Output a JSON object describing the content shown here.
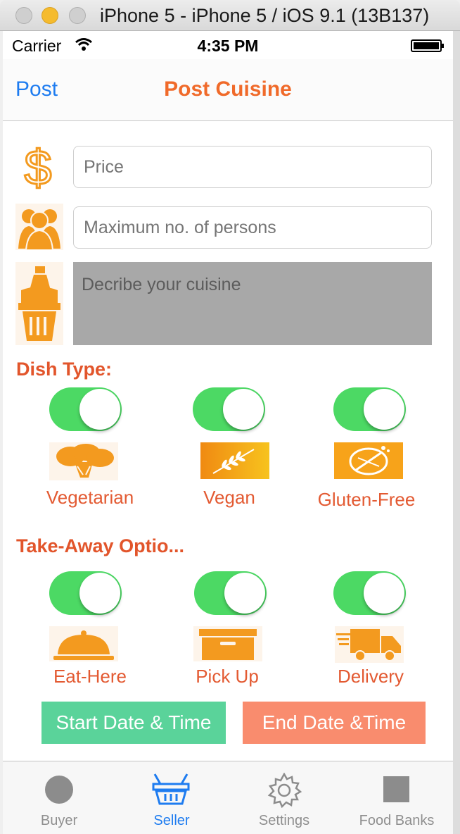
{
  "window": {
    "title": "iPhone 5 - iPhone 5 / iOS 9.1 (13B137)"
  },
  "status": {
    "carrier": "Carrier",
    "time": "4:35 PM"
  },
  "nav": {
    "left": "Post",
    "title": "Post Cuisine"
  },
  "form": {
    "price_placeholder": "Price",
    "persons_placeholder": "Maximum no. of persons",
    "describe_placeholder": "Decribe your cuisine"
  },
  "dish_type": {
    "title": "Dish Type:",
    "options": [
      {
        "label": "Vegetarian",
        "on": true,
        "icon": "broccoli-icon"
      },
      {
        "label": "Vegan",
        "on": true,
        "icon": "wheat-icon"
      },
      {
        "label": "Gluten-Free",
        "on": true,
        "icon": "no-gluten-icon"
      }
    ]
  },
  "takeaway": {
    "title": "Take-Away Optio...",
    "options": [
      {
        "label": "Eat-Here",
        "on": true,
        "icon": "cloche-icon"
      },
      {
        "label": "Pick Up",
        "on": true,
        "icon": "box-icon"
      },
      {
        "label": "Delivery",
        "on": true,
        "icon": "truck-icon"
      }
    ]
  },
  "buttons": {
    "start": "Start Date & Time",
    "end": "End Date &Time"
  },
  "tabs": [
    {
      "label": "Buyer",
      "icon": "circle-icon",
      "active": false
    },
    {
      "label": "Seller",
      "icon": "basket-icon",
      "active": true
    },
    {
      "label": "Settings",
      "icon": "gear-icon",
      "active": false
    },
    {
      "label": "Food Banks",
      "icon": "square-icon",
      "active": false
    }
  ],
  "colors": {
    "accent": "#f06a2a",
    "icon_orange": "#f39a1f",
    "toggle_on": "#4cd964",
    "tab_active": "#1e7cf0"
  }
}
